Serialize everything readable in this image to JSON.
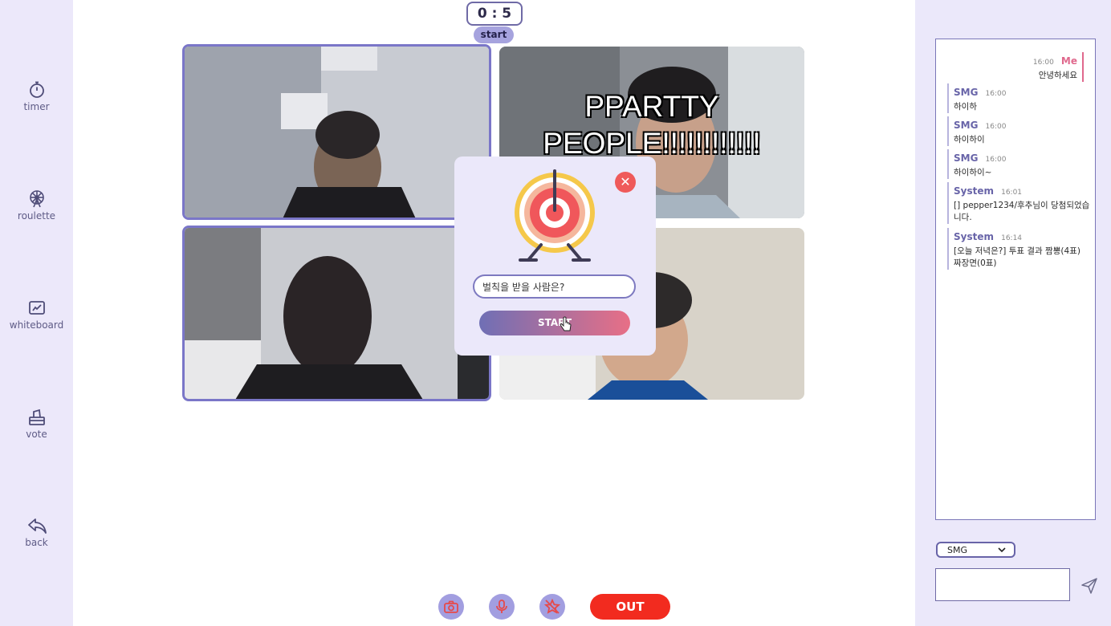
{
  "sidebar": {
    "items": [
      {
        "label": "timer",
        "icon": "stopwatch-icon"
      },
      {
        "label": "roulette",
        "icon": "ferris-wheel-icon"
      },
      {
        "label": "whiteboard",
        "icon": "whiteboard-icon"
      },
      {
        "label": "vote",
        "icon": "ballot-box-icon"
      },
      {
        "label": "back",
        "icon": "back-arrow-icon"
      }
    ]
  },
  "timer": {
    "display": "0 : 5",
    "start_label": "start"
  },
  "videos": [
    {
      "overlay_text": ""
    },
    {
      "overlay_text": "PPARTTY\nPEOPLE!!!!!!!!!!!!"
    },
    {
      "overlay_text": ""
    },
    {
      "overlay_text": ""
    }
  ],
  "roulette": {
    "input_value": "벌칙을 받을 사람은?",
    "start_label": "START",
    "close_label": "✕"
  },
  "controls": {
    "out_label": "OUT"
  },
  "chat": {
    "messages": [
      {
        "sender": "Me",
        "time": "16:00",
        "text": "안녕하세요",
        "mine": true
      },
      {
        "sender": "SMG",
        "time": "16:00",
        "text": "하이하",
        "mine": false
      },
      {
        "sender": "SMG",
        "time": "16:00",
        "text": "하이하이",
        "mine": false
      },
      {
        "sender": "SMG",
        "time": "16:00",
        "text": "하이하이~",
        "mine": false
      },
      {
        "sender": "System",
        "time": "16:01",
        "text": "[] pepper1234/후추님이 당첨되었습니다.",
        "mine": false
      },
      {
        "sender": "System",
        "time": "16:14",
        "text": "[오늘 저녁은?] 투표 결과 짬뽕(4표) 짜장면(0표)",
        "mine": false
      }
    ],
    "recipient": "SMG",
    "input_value": ""
  },
  "colors": {
    "accent": "#7a76c8",
    "sidebar_bg": "#ece8fa",
    "danger": "#f22b1f",
    "me_accent": "#e0698d"
  }
}
